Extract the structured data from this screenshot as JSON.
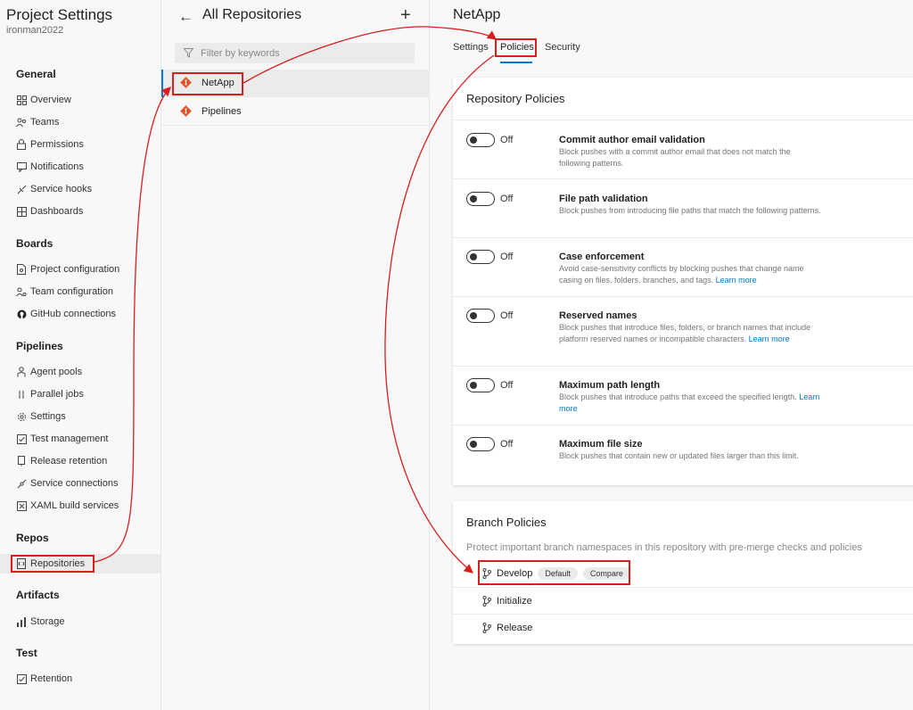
{
  "left_nav": {
    "title": "Project Settings",
    "subtitle": "ironman2022",
    "sections": {
      "general": {
        "label": "General",
        "items": [
          "Overview",
          "Teams",
          "Permissions",
          "Notifications",
          "Service hooks",
          "Dashboards"
        ]
      },
      "boards": {
        "label": "Boards",
        "items": [
          "Project configuration",
          "Team configuration",
          "GitHub connections"
        ]
      },
      "pipelines": {
        "label": "Pipelines",
        "items": [
          "Agent pools",
          "Parallel jobs",
          "Settings",
          "Test management",
          "Release retention",
          "Service connections",
          "XAML build services"
        ]
      },
      "repos": {
        "label": "Repos",
        "items": [
          "Repositories"
        ]
      },
      "artifacts": {
        "label": "Artifacts",
        "items": [
          "Storage"
        ]
      },
      "test": {
        "label": "Test",
        "items": [
          "Retention"
        ]
      }
    },
    "active_item": "Repositories"
  },
  "repos_panel": {
    "title": "All Repositories",
    "filter_placeholder": "Filter by keywords",
    "items": [
      "NetApp",
      "Pipelines"
    ],
    "selected": "NetApp"
  },
  "detail": {
    "repo_name": "NetApp",
    "tabs": [
      "Settings",
      "Policies",
      "Security"
    ],
    "active_tab": "Policies",
    "repository_policies": {
      "title": "Repository Policies",
      "policies": [
        {
          "state": "Off",
          "name": "Commit author email validation",
          "desc": "Block pushes with a commit author email that does not match the following patterns.",
          "link": ""
        },
        {
          "state": "Off",
          "name": "File path validation",
          "desc": "Block pushes from introducing file paths that match the following patterns.",
          "link": ""
        },
        {
          "state": "Off",
          "name": "Case enforcement",
          "desc": "Avoid case-sensitivity conflicts by blocking pushes that change name casing on files, folders, branches, and tags.",
          "link": "Learn more"
        },
        {
          "state": "Off",
          "name": "Reserved names",
          "desc": "Block pushes that introduce files, folders, or branch names that include platform reserved names or incompatible characters.",
          "link": "Learn more"
        },
        {
          "state": "Off",
          "name": "Maximum path length",
          "desc": "Block pushes that introduce paths that exceed the specified length.",
          "link": "Learn more"
        },
        {
          "state": "Off",
          "name": "Maximum file size",
          "desc": "Block pushes that contain new or updated files larger than this limit.",
          "link": ""
        }
      ]
    },
    "branch_policies": {
      "title": "Branch Policies",
      "desc": "Protect important branch namespaces in this repository with pre-merge checks and policies",
      "branches": [
        {
          "name": "Develop",
          "badges": [
            "Default",
            "Compare"
          ]
        },
        {
          "name": "Initialize",
          "badges": []
        },
        {
          "name": "Release",
          "badges": []
        }
      ]
    }
  },
  "colors": {
    "accent": "#0078d4",
    "annotation": "#d91e1e",
    "git_icon": "#e8542a"
  }
}
